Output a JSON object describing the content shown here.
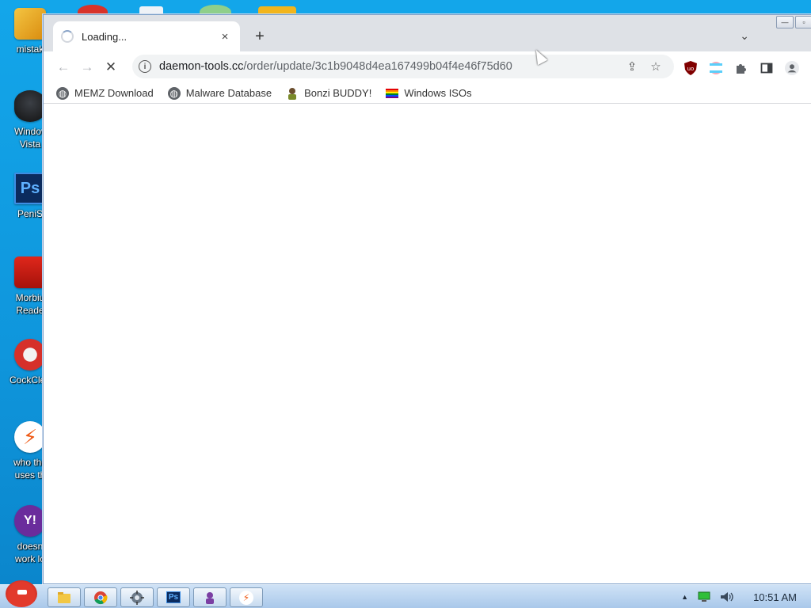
{
  "desktop": {
    "icons": [
      {
        "label": "mistak",
        "icon": "folder-installer-icon"
      },
      {
        "label": "Windov\nVista",
        "icon": "windows-vista-icon"
      },
      {
        "label": "PeniS",
        "icon": "photoshop-icon",
        "glyph": "Ps"
      },
      {
        "label": "Morbiu\nReade",
        "icon": "acrobat-reader-icon"
      },
      {
        "label": "CockClea",
        "icon": "ccleaner-icon"
      },
      {
        "label": "who the\nuses th",
        "icon": "lightning-app-icon"
      },
      {
        "label": "doesn\nwork lo",
        "icon": "yahoo-messenger-icon",
        "glyph": "Y!"
      }
    ]
  },
  "browser": {
    "tab": {
      "title": "Loading...",
      "close": "×"
    },
    "new_tab": "+",
    "tab_menu": "⌄",
    "window_controls": {
      "minimize": "—",
      "restore": "▫"
    },
    "nav": {
      "back": "←",
      "forward": "→",
      "stop": "✕"
    },
    "url": {
      "host": "daemon-tools.cc",
      "path": "/order/update/3c1b9048d4ea167499b04f4e46f75d60"
    },
    "omnibox_icons": {
      "share": "⇪",
      "bookmark": "☆"
    },
    "extensions": [
      "ublock-origin-icon",
      "flag-extension-icon",
      "puzzle-icon",
      "side-panel-icon",
      "profile-icon"
    ],
    "bookmarks": [
      {
        "label": "MEMZ Download",
        "icon": "globe-icon"
      },
      {
        "label": "Malware Database",
        "icon": "globe-icon"
      },
      {
        "label": "Bonzi BUDDY!",
        "icon": "bonzi-icon"
      },
      {
        "label": "Windows ISOs",
        "icon": "rainbow-flag-icon"
      }
    ]
  },
  "taskbar": {
    "buttons": [
      "explorer-icon",
      "chrome-icon",
      "network-icon",
      "photoshop-icon",
      "bonzi-icon",
      "lightning-app-icon"
    ],
    "photoshop_glyph": "Ps",
    "tray": {
      "chevron": "▲",
      "clock": "10:51 AM"
    }
  },
  "colors": {
    "desktop_bg": "#13a6ea",
    "tabstrip_bg": "#dee1e6",
    "omnibox_bg": "#f1f3f4",
    "taskbar_bg": "#bcd5ef"
  }
}
